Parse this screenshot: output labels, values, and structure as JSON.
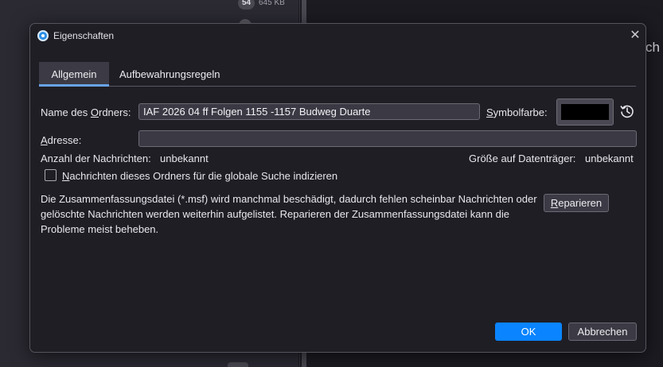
{
  "background": {
    "badge_count": "54",
    "size_text": "645 KB",
    "peek_text": "ch"
  },
  "dialog": {
    "title": "Eigenschaften",
    "close_glyph": "✕",
    "icons": {
      "app": "thunderbird-icon",
      "close": "close-icon",
      "reset_color": "reset-history-icon"
    },
    "tabs": [
      {
        "label": "Allgemein",
        "active": true
      },
      {
        "label": "Aufbewahrungsregeln",
        "active": false
      }
    ],
    "folder_name": {
      "label_prefix": "Name des ",
      "label_underlined": "O",
      "label_suffix": "rdners:",
      "value": "IAF 2026 04 ff Folgen 1155 -1157 Budweg Duarte"
    },
    "symbol_color": {
      "label_underlined": "S",
      "label_suffix": "ymbolfarbe:",
      "value": "#000000"
    },
    "address": {
      "label_underlined": "A",
      "label_suffix": "dresse:",
      "value": ""
    },
    "message_count": {
      "label": "Anzahl der Nachrichten:",
      "value": "unbekannt"
    },
    "disk_size": {
      "label": "Größe auf Datenträger:",
      "value": "unbekannt"
    },
    "index_checkbox": {
      "label_underlined": "N",
      "label_suffix": "achrichten dieses Ordners für die globale Suche indizieren",
      "checked": false
    },
    "summary_text": "Die Zusammenfassungsdatei (*.msf) wird manchmal beschädigt, dadurch fehlen scheinbar Nachrichten oder gelöschte Nachrichten werden weiterhin aufgelistet. Reparieren der Zusammenfassungsdatei kann die Probleme meist beheben.",
    "repair_button": {
      "label_underlined": "R",
      "label_suffix": "eparieren"
    },
    "ok_label": "OK",
    "cancel_label": "Abbrechen"
  },
  "colors": {
    "accent": "#0a84ff",
    "tab_indicator": "#69a4e6",
    "dialog_bg": "#1f1e25"
  }
}
